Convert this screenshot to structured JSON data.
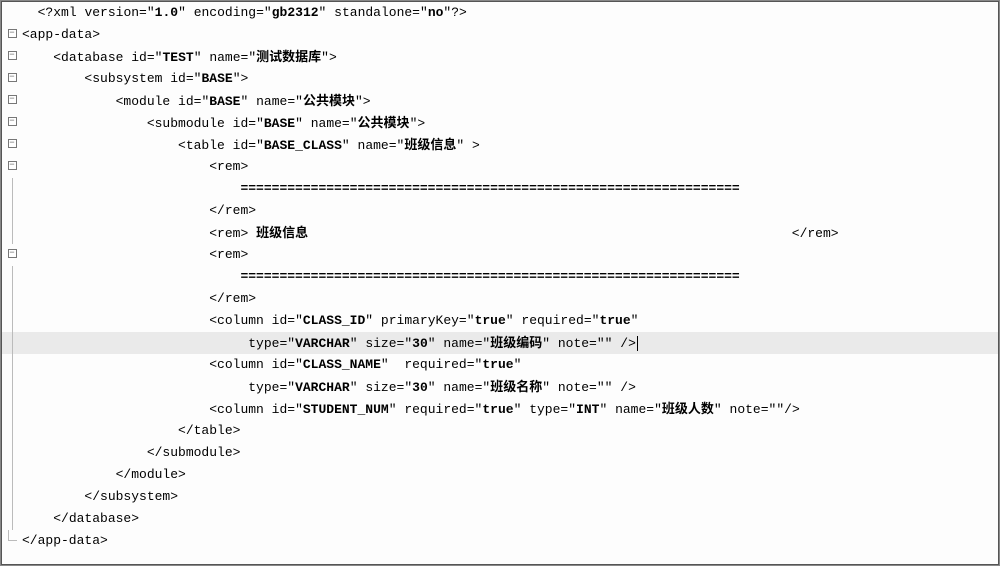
{
  "xml_decl": {
    "open": "<?xml",
    "version_attr": "version=",
    "version_val": "1.0",
    "encoding_attr": "encoding=",
    "encoding_val": "gb2312",
    "standalone_attr": "standalone=",
    "standalone_val": "no",
    "close": "?>"
  },
  "guides": {
    "i1": "│",
    "i2": "│   │",
    "i3": "│   │   │",
    "i4": "│   │   │   │",
    "i5": "│   │   │   │   │",
    "i6": "│   │   │   │   │   │"
  },
  "root_open": "<app-data>",
  "root_close": "</app-data>",
  "database": {
    "tag_open": "<database",
    "id_attr": "id=",
    "id_val": "TEST",
    "name_attr": "name=",
    "name_val": "测试数据库",
    "close_bracket": ">",
    "tag_close": "</database>"
  },
  "subsystem": {
    "tag_open": "<subsystem",
    "id_attr": "id=",
    "id_val": "BASE",
    "close_bracket": ">",
    "tag_close": "</subsystem>"
  },
  "module": {
    "tag_open": "<module",
    "id_attr": "id=",
    "id_val": "BASE",
    "name_attr": "name=",
    "name_val": "公共模块",
    "close_bracket": ">",
    "tag_close": "</module>"
  },
  "submodule": {
    "tag_open": "<submodule",
    "id_attr": "id=",
    "id_val": "BASE",
    "name_attr": "name=",
    "name_val": "公共模块",
    "close_bracket": ">",
    "tag_close": "</submodule>"
  },
  "table": {
    "tag_open": "<table",
    "id_attr": "id=",
    "id_val": "BASE_CLASS",
    "name_attr": "name=",
    "name_val": "班级信息",
    "close_bracket": " >",
    "tag_close": "</table>"
  },
  "rem": {
    "open": "<rem>",
    "close": "</rem>",
    "sep1": "================================================================",
    "text": "班级信息",
    "sep2": "================================================================"
  },
  "col1": {
    "tag_open": "<column",
    "id_attr": "id=",
    "id_val": "CLASS_ID",
    "pk_attr": "primaryKey=",
    "pk_val": "true",
    "req_attr": "required=",
    "req_val": "true",
    "type_attr": "type=",
    "type_val": "VARCHAR",
    "size_attr": "size=",
    "size_val": "30",
    "name_attr": "name=",
    "name_val": "班级编码",
    "note_attr": "note=",
    "note_val": "",
    "self_close": " />"
  },
  "col2": {
    "tag_open": "<column",
    "id_attr": "id=",
    "id_val": "CLASS_NAME",
    "req_attr": "required=",
    "req_val": "true",
    "type_attr": "type=",
    "type_val": "VARCHAR",
    "size_attr": "size=",
    "size_val": "30",
    "name_attr": "name=",
    "name_val": "班级名称",
    "note_attr": "note=",
    "note_val": "",
    "self_close": " />"
  },
  "col3": {
    "tag_open": "<column",
    "id_attr": "id=",
    "id_val": "STUDENT_NUM",
    "req_attr": "required=",
    "req_val": "true",
    "type_attr": "type=",
    "type_val": "INT",
    "name_attr": "name=",
    "name_val": "班级人数",
    "note_attr": "note=",
    "note_val": "",
    "self_close": "/>"
  },
  "quote": "\"",
  "space": " ",
  "fold_minus": "−"
}
